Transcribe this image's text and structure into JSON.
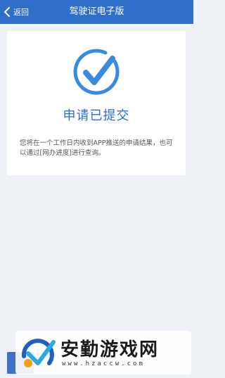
{
  "header": {
    "back_label": "返回",
    "title": "驾驶证电子版"
  },
  "result": {
    "title": "申请已提交",
    "description": "您将在一个工作日内收到APP推送的申请结果，也可以通过[网办进度]进行查询。",
    "icon": "check-circle-icon",
    "accent_color": "#2a6fcf"
  },
  "colors": {
    "nav_bar": "#2f6ec9",
    "page_bg": "#eef1f5"
  },
  "watermark": {
    "name": "安勤游戏网",
    "url": "www.hzaccw.com"
  }
}
